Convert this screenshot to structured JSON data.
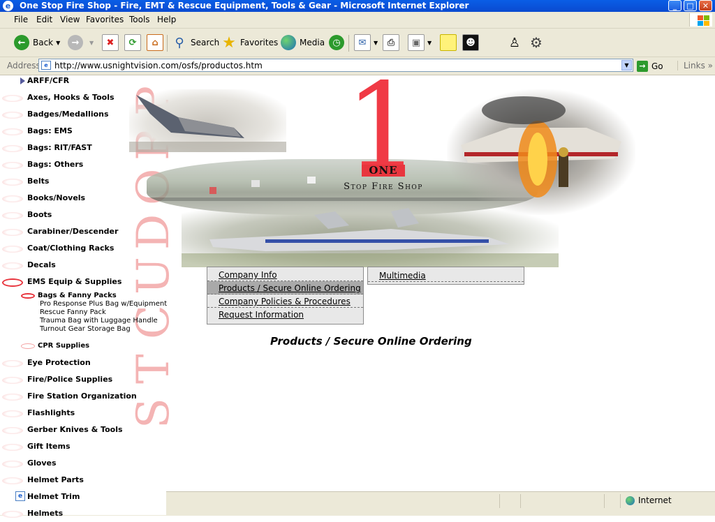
{
  "window": {
    "title": "One Stop Fire Shop - Fire, EMT & Rescue Equipment, Tools & Gear - Microsoft Internet Explorer",
    "minimize_label": "_",
    "maximize_label": "□",
    "close_label": "✕"
  },
  "menubar": {
    "items": [
      "File",
      "Edit",
      "View",
      "Favorites",
      "Tools",
      "Help"
    ]
  },
  "toolbar": {
    "back": "Back",
    "search": "Search",
    "favorites": "Favorites",
    "media": "Media"
  },
  "address": {
    "label": "Address",
    "url": "http://www.usnightvision.com/osfs/productos.htm",
    "go": "Go",
    "links": "Links"
  },
  "watermark": {
    "letters": [
      "P",
      "R",
      "O",
      "D",
      "U",
      "C",
      "T",
      "S"
    ]
  },
  "leftnav": {
    "items": [
      {
        "label": "ARFF/CFR"
      },
      {
        "label": "Axes, Hooks & Tools"
      },
      {
        "label": "Badges/Medallions"
      },
      {
        "label": "Bags: EMS"
      },
      {
        "label": "Bags: RIT/FAST"
      },
      {
        "label": "Bags: Others"
      },
      {
        "label": "Belts"
      },
      {
        "label": "Books/Novels"
      },
      {
        "label": "Boots"
      },
      {
        "label": "Carabiner/Descender"
      },
      {
        "label": "Coat/Clothing Racks"
      },
      {
        "label": "Decals"
      },
      {
        "label": "EMS Equip & Supplies"
      }
    ],
    "ems_sub": {
      "bags_fanny": "Bags & Fanny Packs",
      "leaves": [
        "Pro Response Plus Bag w/Equipment",
        "Rescue Fanny Pack",
        "Trauma Bag with Luggage Handle",
        "Turnout Gear Storage Bag"
      ],
      "cpr": "CPR Supplies"
    },
    "items_after": [
      {
        "label": "Eye Protection"
      },
      {
        "label": "Fire/Police Supplies"
      },
      {
        "label": "Fire Station Organization"
      },
      {
        "label": "Flashlights"
      },
      {
        "label": "Gerber Knives & Tools"
      },
      {
        "label": "Gift Items"
      },
      {
        "label": "Gloves"
      },
      {
        "label": "Helmet Parts"
      },
      {
        "label": "Helmet Trim"
      },
      {
        "label": "Helmets"
      }
    ]
  },
  "banner": {
    "logo_number": "1",
    "logo_one": "ONE",
    "tagline": "Stop Fire Shop"
  },
  "site_menu": {
    "left": [
      "Company Info",
      "Products / Secure Online Ordering",
      "Company Policies & Procedures",
      "Request Information"
    ],
    "right": [
      "Multimedia"
    ],
    "selected": "Products / Secure Online Ordering"
  },
  "page": {
    "title": "Products / Secure Online Ordering"
  },
  "status": {
    "zone": "Internet"
  },
  "colors": {
    "accent_red": "#e8353e",
    "xp_blue": "#0a5ee6",
    "chrome": "#ece9d8"
  }
}
